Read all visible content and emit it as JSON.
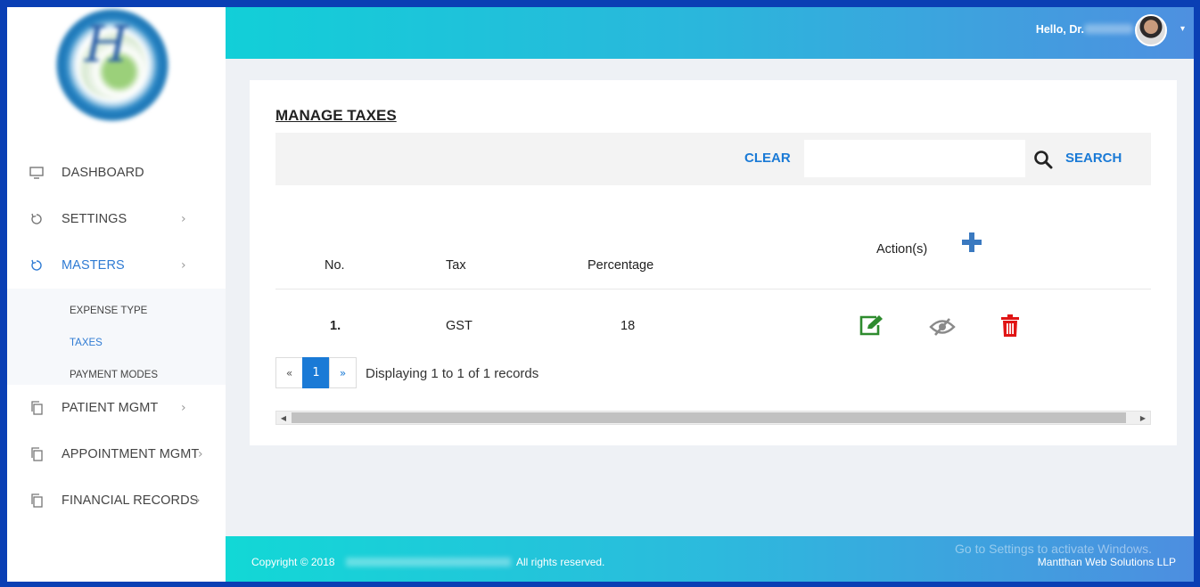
{
  "header": {
    "greeting": "Hello, Dr."
  },
  "sidebar": {
    "items": [
      {
        "label": "DASHBOARD",
        "icon": "monitor-icon"
      },
      {
        "label": "SETTINGS",
        "icon": "refresh-icon"
      },
      {
        "label": "MASTERS",
        "icon": "refresh-icon",
        "active": true
      },
      {
        "label": "PATIENT MGMT",
        "icon": "copy-icon"
      },
      {
        "label": "APPOINTMENT MGMT",
        "icon": "copy-icon"
      },
      {
        "label": "FINANCIAL RECORDS",
        "icon": "copy-icon"
      }
    ],
    "submenu": [
      {
        "label": "EXPENSE TYPE"
      },
      {
        "label": "TAXES",
        "active": true
      },
      {
        "label": "PAYMENT MODES"
      }
    ],
    "chevron": "›"
  },
  "main": {
    "title": "MANAGE TAXES",
    "clear_label": "CLEAR",
    "search_label": "SEARCH",
    "search_value": "",
    "table": {
      "headers": [
        "No.",
        "Tax",
        "Percentage",
        "Action(s)"
      ],
      "rows": [
        {
          "no": "1.",
          "tax": "GST",
          "percentage": "18"
        }
      ]
    },
    "pagination": {
      "prev": "«",
      "current": "1",
      "next": "»",
      "info": "Displaying 1 to 1 of 1 records"
    }
  },
  "footer": {
    "copyright": "Copyright © 2018",
    "rights": "All rights reserved.",
    "company": "Mantthan Web Solutions LLP"
  },
  "watermark": "Go to Settings to activate Windows.",
  "colors": {
    "accent": "#1a7ad6",
    "edit": "#2e8b2e",
    "delete": "#e01414",
    "view": "#888888"
  }
}
